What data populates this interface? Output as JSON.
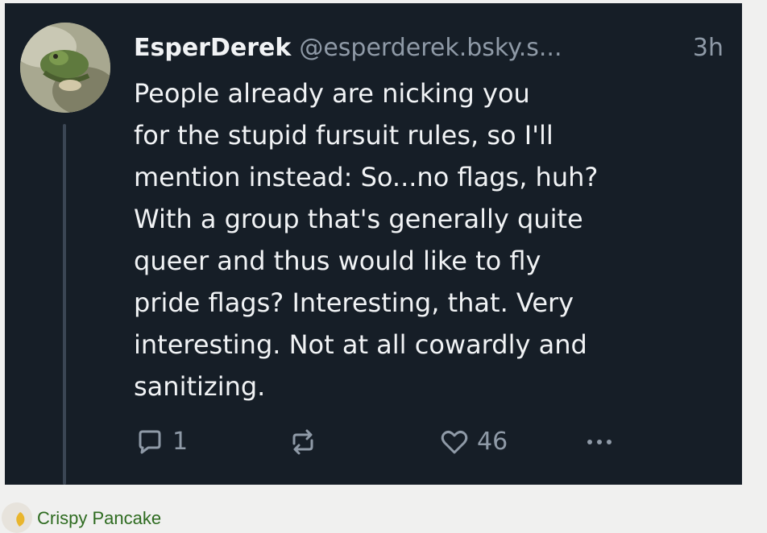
{
  "post": {
    "author_name": "EsperDerek",
    "author_handle": "@esperderek.bsky.s...",
    "time": "3h",
    "body_lines": [
      "People already are nicking you",
      "for the stupid fursuit rules, so I'll",
      "mention instead: So...no flags, huh?",
      "With a group that's generally quite",
      "queer and thus would like to fly",
      "pride flags? Interesting, that. Very",
      "interesting. Not at all cowardly and",
      "sanitizing."
    ],
    "reply_count": "1",
    "like_count": "46",
    "icons": {
      "reply": "reply-icon",
      "repost": "repost-icon",
      "like": "heart-icon",
      "more": "ellipsis-icon"
    },
    "colors": {
      "background": "#161e27",
      "text": "#f1f3f5",
      "muted": "#8f9aa7"
    }
  },
  "footer": {
    "user_name": "Crispy Pancake",
    "link_color": "#2e6b20"
  }
}
